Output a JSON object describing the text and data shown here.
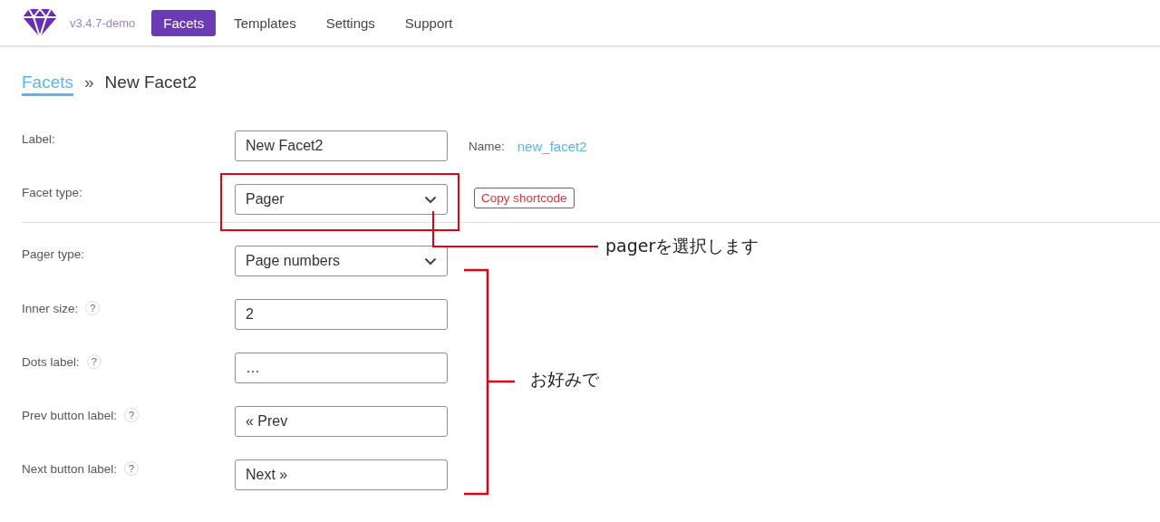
{
  "nav": {
    "version": "v3.4.7-demo",
    "items": [
      {
        "label": "Facets",
        "selected": true
      },
      {
        "label": "Templates",
        "selected": false
      },
      {
        "label": "Settings",
        "selected": false
      },
      {
        "label": "Support",
        "selected": false
      }
    ]
  },
  "breadcrumb": {
    "parent": "Facets",
    "separator": "»",
    "current": "New Facet2"
  },
  "fields": [
    {
      "label": "Label:",
      "kind": "text",
      "value": "New Facet2",
      "name_label": "Name:",
      "name_value": "new_facet2"
    },
    {
      "label": "Facet type:",
      "kind": "select",
      "value": "Pager",
      "action": "Copy shortcode"
    }
  ],
  "pager_fields": [
    {
      "label": "Pager type:",
      "kind": "select",
      "value": "Page numbers"
    },
    {
      "label": "Inner size:",
      "kind": "text",
      "value": "2",
      "help": "?"
    },
    {
      "label": "Dots label:",
      "kind": "text",
      "value": "…",
      "help": "?"
    },
    {
      "label": "Prev button label:",
      "kind": "text",
      "value": "« Prev",
      "help": "?"
    },
    {
      "label": "Next button label:",
      "kind": "text",
      "value": "Next »",
      "help": "?"
    }
  ],
  "annotations": [
    {
      "kind": "callout",
      "text": "pagerを選択します"
    },
    {
      "kind": "bracket",
      "text": "お好みで"
    }
  ]
}
